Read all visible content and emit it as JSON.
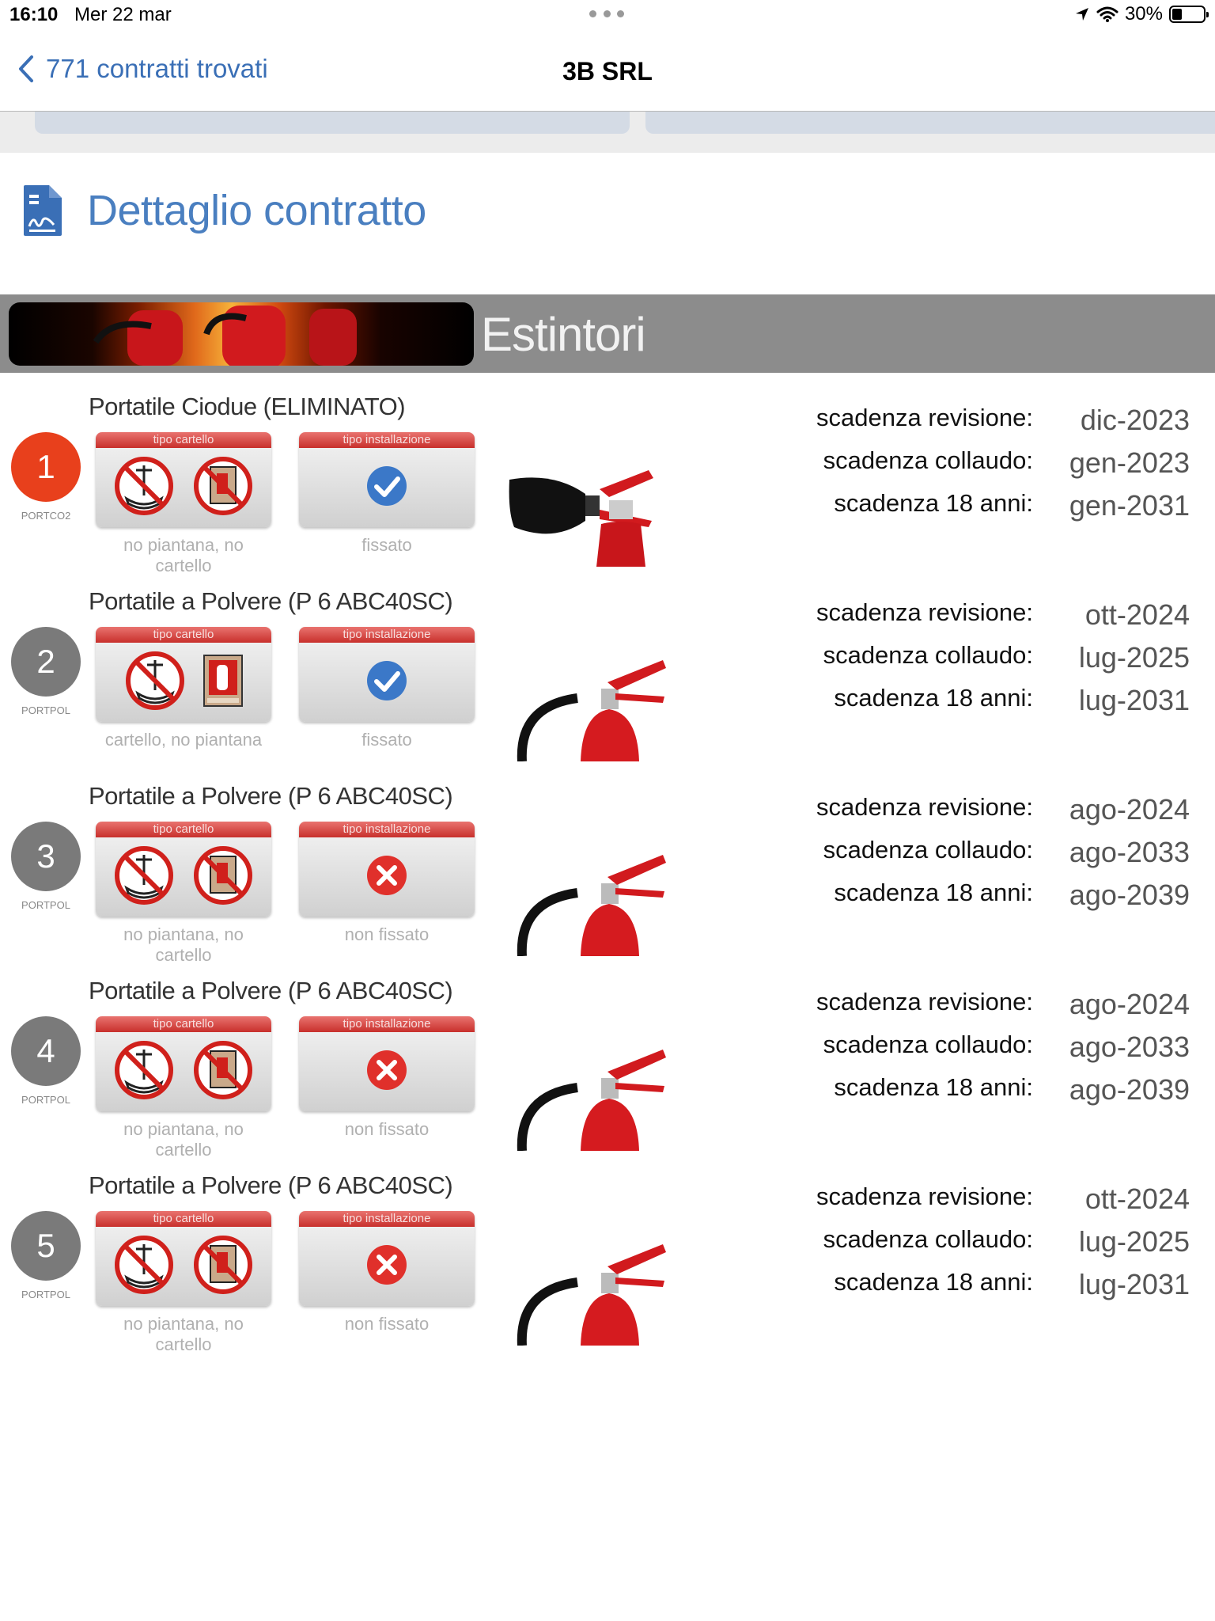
{
  "status": {
    "time": "16:10",
    "date": "Mer 22 mar",
    "battery": "30%"
  },
  "nav": {
    "back_label": "771 contratti trovati",
    "title": "3B SRL"
  },
  "detail_title": "Dettaglio contratto",
  "section_title": "Estintori",
  "labels": {
    "card_cartello": "tipo cartello",
    "card_installazione": "tipo installazione",
    "revisione": "scadenza revisione:",
    "collaudo": "scadenza collaudo:",
    "anni18": "scadenza 18 anni:"
  },
  "rows": [
    {
      "num": "1",
      "code": "PORTCO2",
      "badge_color": "#e8401c",
      "name": "Portatile Ciodue (ELIMINATO)",
      "cartello": "no piantana, no cartello",
      "cartello_icons": [
        "no-piantana-icon",
        "no-cartello-icon"
      ],
      "installazione": "fissato",
      "install_icon": "check-icon",
      "extinguisher": "co2-extinguisher-image",
      "revisione": "dic-2023",
      "collaudo": "gen-2023",
      "anni18": "gen-2031"
    },
    {
      "num": "2",
      "code": "PORTPOL",
      "badge_color": "#7a7a7a",
      "name": "Portatile a Polvere (P 6 ABC40SC)",
      "cartello": "cartello, no piantana",
      "cartello_icons": [
        "no-piantana-icon",
        "cartello-icon"
      ],
      "installazione": "fissato",
      "install_icon": "check-icon",
      "extinguisher": "powder-extinguisher-image",
      "revisione": "ott-2024",
      "collaudo": "lug-2025",
      "anni18": "lug-2031"
    },
    {
      "num": "3",
      "code": "PORTPOL",
      "badge_color": "#7a7a7a",
      "name": "Portatile a Polvere (P 6 ABC40SC)",
      "cartello": "no piantana, no cartello",
      "cartello_icons": [
        "no-piantana-icon",
        "no-cartello-icon"
      ],
      "installazione": "non fissato",
      "install_icon": "cross-icon",
      "extinguisher": "powder-extinguisher-image",
      "revisione": "ago-2024",
      "collaudo": "ago-2033",
      "anni18": "ago-2039"
    },
    {
      "num": "4",
      "code": "PORTPOL",
      "badge_color": "#7a7a7a",
      "name": "Portatile a Polvere (P 6 ABC40SC)",
      "cartello": "no piantana, no cartello",
      "cartello_icons": [
        "no-piantana-icon",
        "no-cartello-icon"
      ],
      "installazione": "non fissato",
      "install_icon": "cross-icon",
      "extinguisher": "powder-extinguisher-image",
      "revisione": "ago-2024",
      "collaudo": "ago-2033",
      "anni18": "ago-2039"
    },
    {
      "num": "5",
      "code": "PORTPOL",
      "badge_color": "#7a7a7a",
      "name": "Portatile a Polvere (P 6 ABC40SC)",
      "cartello": "no piantana, no cartello",
      "cartello_icons": [
        "no-piantana-icon",
        "no-cartello-icon"
      ],
      "installazione": "non fissato",
      "install_icon": "cross-icon",
      "extinguisher": "powder-extinguisher-image",
      "revisione": "ott-2024",
      "collaudo": "lug-2025",
      "anni18": "lug-2031"
    }
  ],
  "colors": {
    "accent": "#3a6fb6",
    "banner": "#8c8c8c",
    "card_header": "#d03a36",
    "check": "#3b78c8",
    "cross": "#e0302b"
  }
}
